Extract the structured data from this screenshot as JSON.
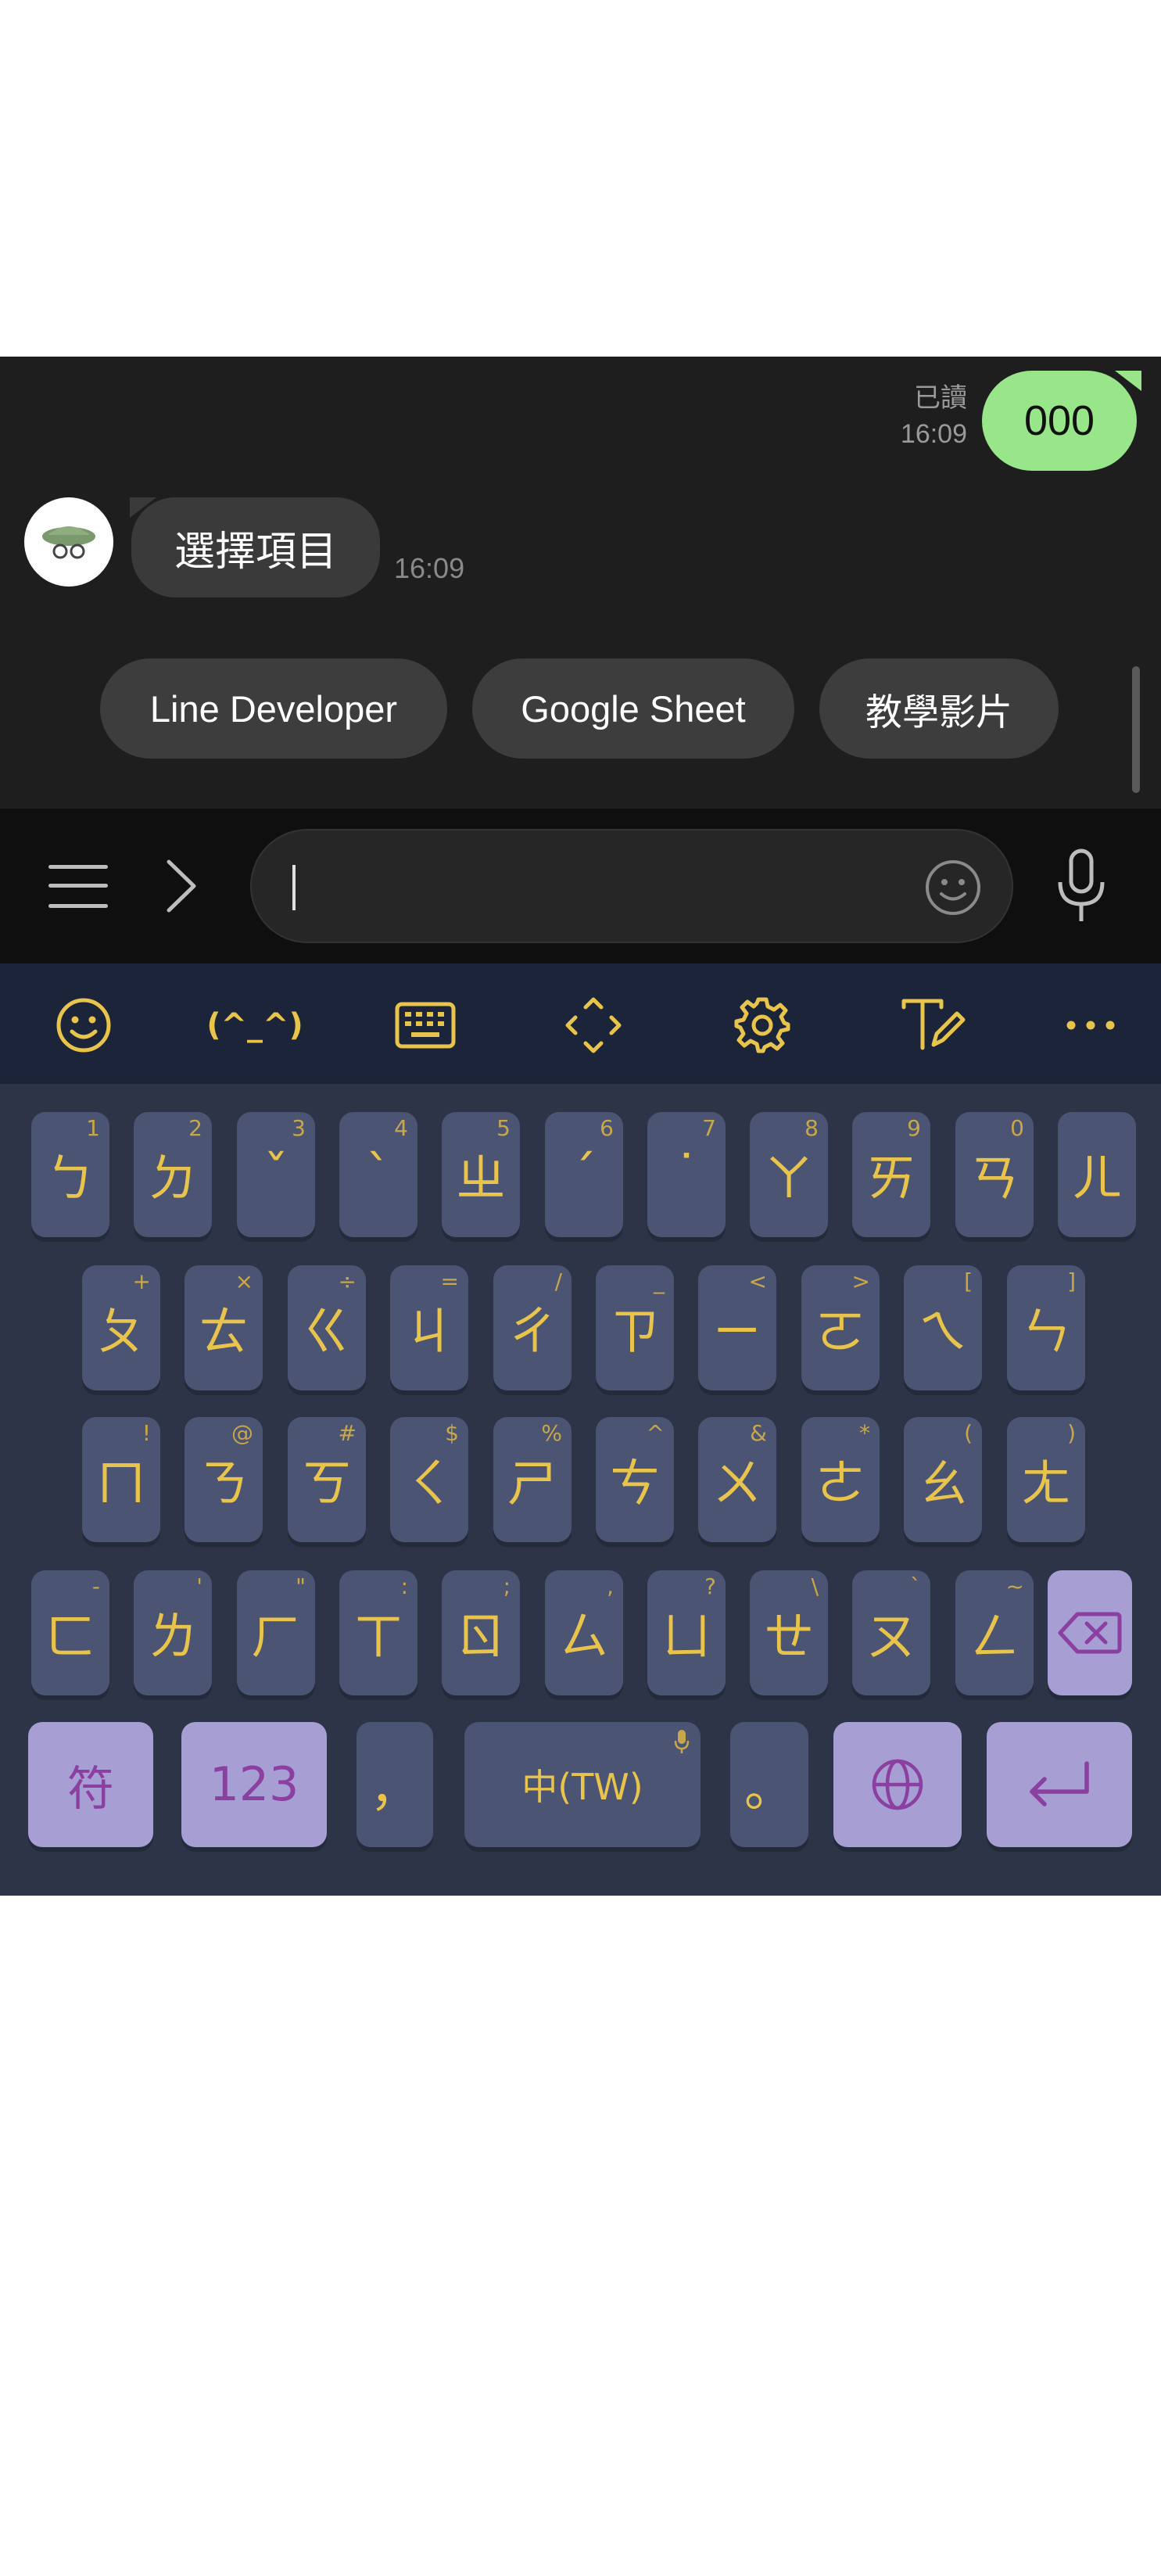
{
  "chat": {
    "outgoing": {
      "text": "000",
      "read_label": "已讀",
      "time": "16:09"
    },
    "incoming": {
      "text": "選擇項目",
      "time": "16:09"
    },
    "quick_replies": [
      "Line Developer",
      "Google Sheet",
      "教學影片"
    ]
  },
  "input": {
    "value": "",
    "placeholder": ""
  },
  "keyboard": {
    "rows": [
      [
        {
          "k": "ㄅ",
          "h": "1"
        },
        {
          "k": "ㄉ",
          "h": "2"
        },
        {
          "k": "ˇ",
          "h": "3"
        },
        {
          "k": "ˋ",
          "h": "4"
        },
        {
          "k": "ㄓ",
          "h": "5"
        },
        {
          "k": "ˊ",
          "h": "6"
        },
        {
          "k": "˙",
          "h": "7"
        },
        {
          "k": "ㄚ",
          "h": "8"
        },
        {
          "k": "ㄞ",
          "h": "9"
        },
        {
          "k": "ㄢ",
          "h": "0"
        },
        {
          "k": "ㄦ",
          "h": ""
        }
      ],
      [
        {
          "k": "ㄆ",
          "h": "+"
        },
        {
          "k": "ㄊ",
          "h": "×"
        },
        {
          "k": "ㄍ",
          "h": "÷"
        },
        {
          "k": "ㄐ",
          "h": "="
        },
        {
          "k": "ㄔ",
          "h": "/"
        },
        {
          "k": "ㄗ",
          "h": "_"
        },
        {
          "k": "ㄧ",
          "h": "<"
        },
        {
          "k": "ㄛ",
          "h": ">"
        },
        {
          "k": "ㄟ",
          "h": "["
        },
        {
          "k": "ㄣ",
          "h": "]"
        }
      ],
      [
        {
          "k": "ㄇ",
          "h": "!"
        },
        {
          "k": "ㄋ",
          "h": "@"
        },
        {
          "k": "ㄎ",
          "h": "#"
        },
        {
          "k": "ㄑ",
          "h": "$"
        },
        {
          "k": "ㄕ",
          "h": "%"
        },
        {
          "k": "ㄘ",
          "h": "^"
        },
        {
          "k": "ㄨ",
          "h": "&"
        },
        {
          "k": "ㄜ",
          "h": "*"
        },
        {
          "k": "ㄠ",
          "h": "("
        },
        {
          "k": "ㄤ",
          "h": ")"
        }
      ],
      [
        {
          "k": "ㄈ",
          "h": "-"
        },
        {
          "k": "ㄌ",
          "h": "'"
        },
        {
          "k": "ㄏ",
          "h": "\""
        },
        {
          "k": "ㄒ",
          "h": ":"
        },
        {
          "k": "ㄖ",
          "h": ";"
        },
        {
          "k": "ㄙ",
          "h": ","
        },
        {
          "k": "ㄩ",
          "h": "?"
        },
        {
          "k": "ㄝ",
          "h": "\\"
        },
        {
          "k": "ㄡ",
          "h": "`"
        },
        {
          "k": "ㄥ",
          "h": "~"
        }
      ]
    ],
    "bottom": {
      "symbols": "符",
      "numbers": "123",
      "comma": "，",
      "space": "中(TW)",
      "period": "。"
    },
    "colors": {
      "key": "#4b5473",
      "glyph": "#e9c44c",
      "special": "#a79fd3",
      "special_glyph": "#8b3fa0"
    }
  },
  "icons": {
    "toolbar": [
      "emoji-icon",
      "kaomoji-icon",
      "keyboard-icon",
      "resize-icon",
      "settings-icon",
      "handwriting-icon",
      "more-icon"
    ],
    "kaomoji": "(^_^)"
  }
}
